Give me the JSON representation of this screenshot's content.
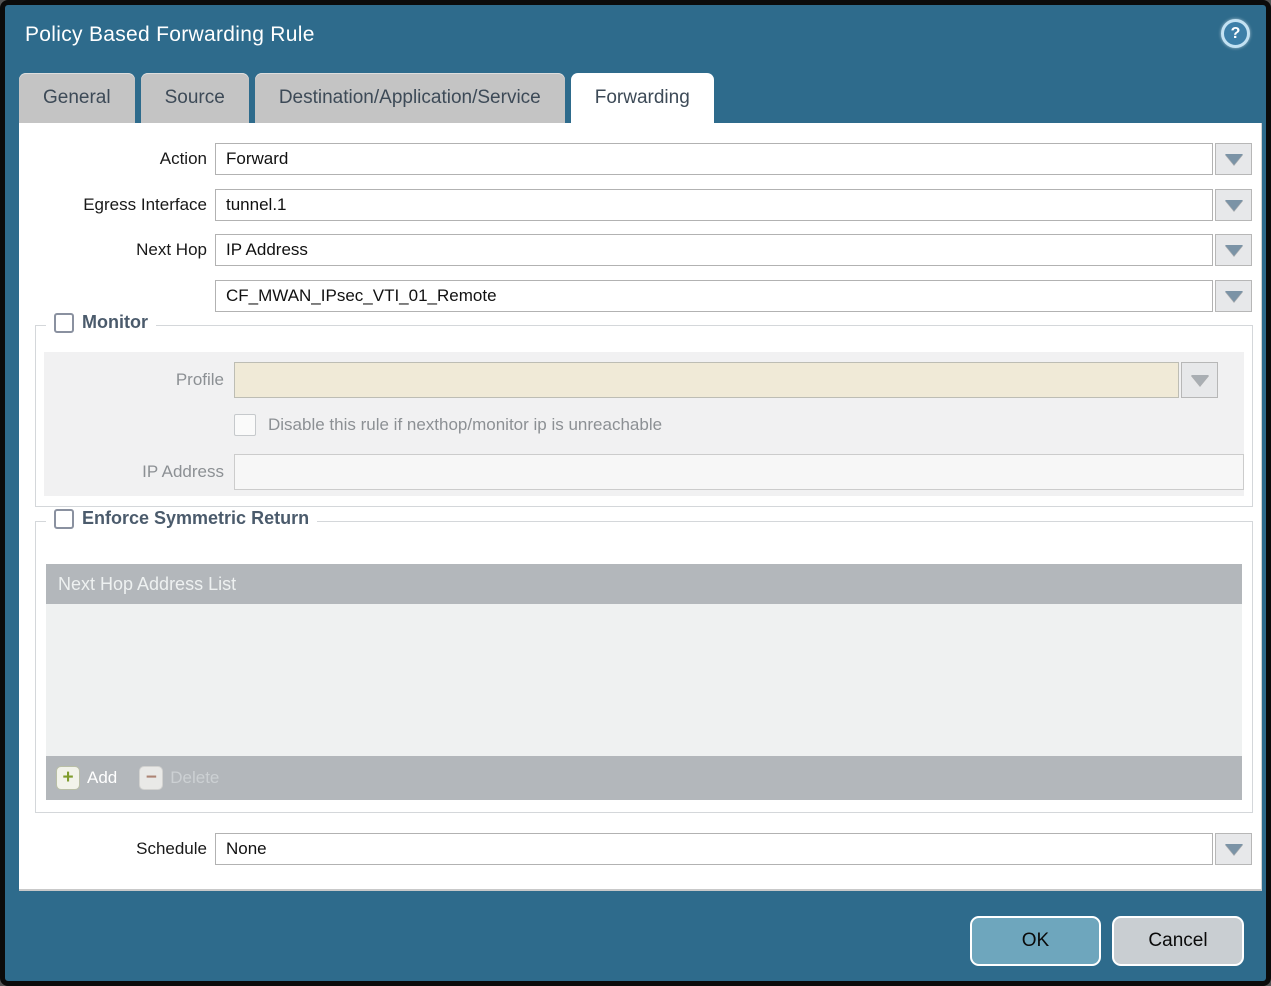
{
  "dialog": {
    "title": "Policy Based Forwarding Rule",
    "help_glyph": "?"
  },
  "tabs": [
    {
      "label": "General"
    },
    {
      "label": "Source"
    },
    {
      "label": "Destination/Application/Service"
    },
    {
      "label": "Forwarding"
    }
  ],
  "form": {
    "action": {
      "label": "Action",
      "value": "Forward"
    },
    "egress_interface": {
      "label": "Egress Interface",
      "value": "tunnel.1"
    },
    "next_hop": {
      "label": "Next Hop",
      "value": "IP Address"
    },
    "next_hop_address": {
      "value": "CF_MWAN_IPsec_VTI_01_Remote"
    },
    "schedule": {
      "label": "Schedule",
      "value": "None"
    }
  },
  "monitor": {
    "legend": "Monitor",
    "checked": false,
    "profile": {
      "label": "Profile",
      "value": ""
    },
    "disable_rule": {
      "label": "Disable this rule if nexthop/monitor ip is unreachable",
      "checked": false
    },
    "ip_address": {
      "label": "IP Address",
      "value": ""
    }
  },
  "enforce_symmetric_return": {
    "legend": "Enforce Symmetric Return",
    "checked": false,
    "table_header": "Next Hop Address List",
    "rows": [],
    "add_label": "Add",
    "delete_label": "Delete",
    "add_glyph": "+",
    "delete_glyph": "−"
  },
  "footer": {
    "ok_label": "OK",
    "cancel_label": "Cancel"
  },
  "colors": {
    "frame_teal": "#2e6b8c",
    "tab_inactive": "#c4c4c4",
    "field_disabled_beige": "#f0ead7",
    "table_gray": "#b3b7bb",
    "ok_blue": "#6ea6bd",
    "arrow_steel_blue": "#7b93a6",
    "add_green": "#7f9c2d",
    "delete_brown": "#ad8474"
  }
}
